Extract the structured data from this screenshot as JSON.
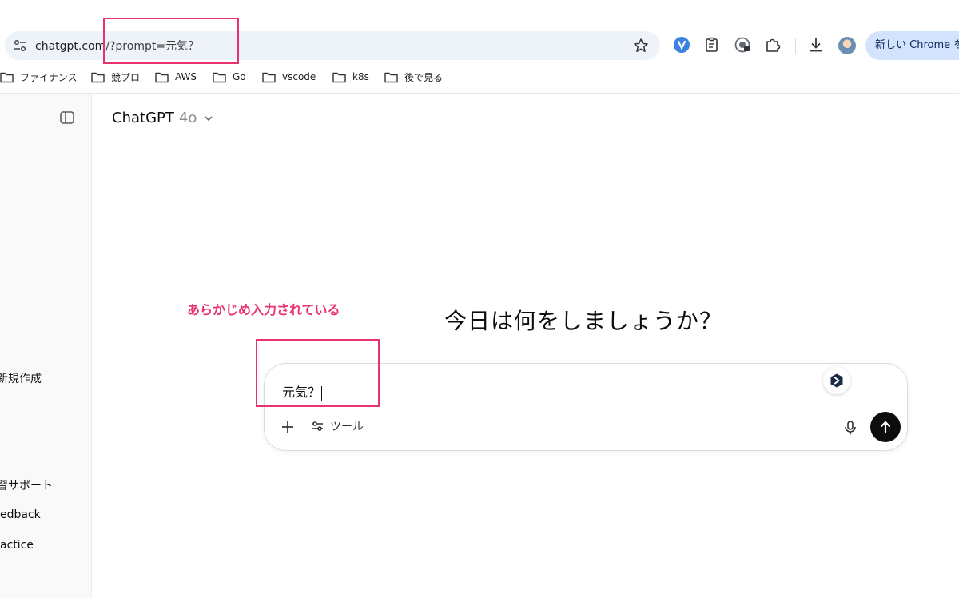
{
  "browser": {
    "url_host": "chatgpt.com",
    "url_path": "/?prompt=元気？",
    "update_button_label": "新しい Chrome を"
  },
  "bookmarks": [
    {
      "label": "ファイナンス"
    },
    {
      "label": "競プロ"
    },
    {
      "label": "AWS"
    },
    {
      "label": "Go"
    },
    {
      "label": "vscode"
    },
    {
      "label": "k8s"
    },
    {
      "label": "後で見る"
    }
  ],
  "sidebar": {
    "items": [
      {
        "label": "新規作成"
      },
      {
        "label": "習サポート"
      },
      {
        "label": "edback"
      },
      {
        "label": "actice"
      }
    ]
  },
  "header": {
    "model_name": "ChatGPT",
    "model_version": "4o"
  },
  "main": {
    "headline": "今日は何をしましょうか？"
  },
  "composer": {
    "input_value": "元気？",
    "tools_label": "ツール"
  },
  "annotation": {
    "label": "あらかじめ入力されている",
    "color": "#e8336d"
  },
  "colors": {
    "omnibox_bg": "#eef2f9",
    "update_button_bg": "#d3e3fd",
    "send_button_bg": "#0d0d0d"
  },
  "icons": [
    "site-settings-icon",
    "star-icon",
    "extension-icon",
    "clipboard-icon",
    "shield-icon",
    "puzzle-icon",
    "download-icon",
    "folder-icon",
    "sidebar-toggle-icon",
    "chevron-down-icon",
    "plus-icon",
    "sliders-icon",
    "mic-icon",
    "arrow-up-icon"
  ]
}
